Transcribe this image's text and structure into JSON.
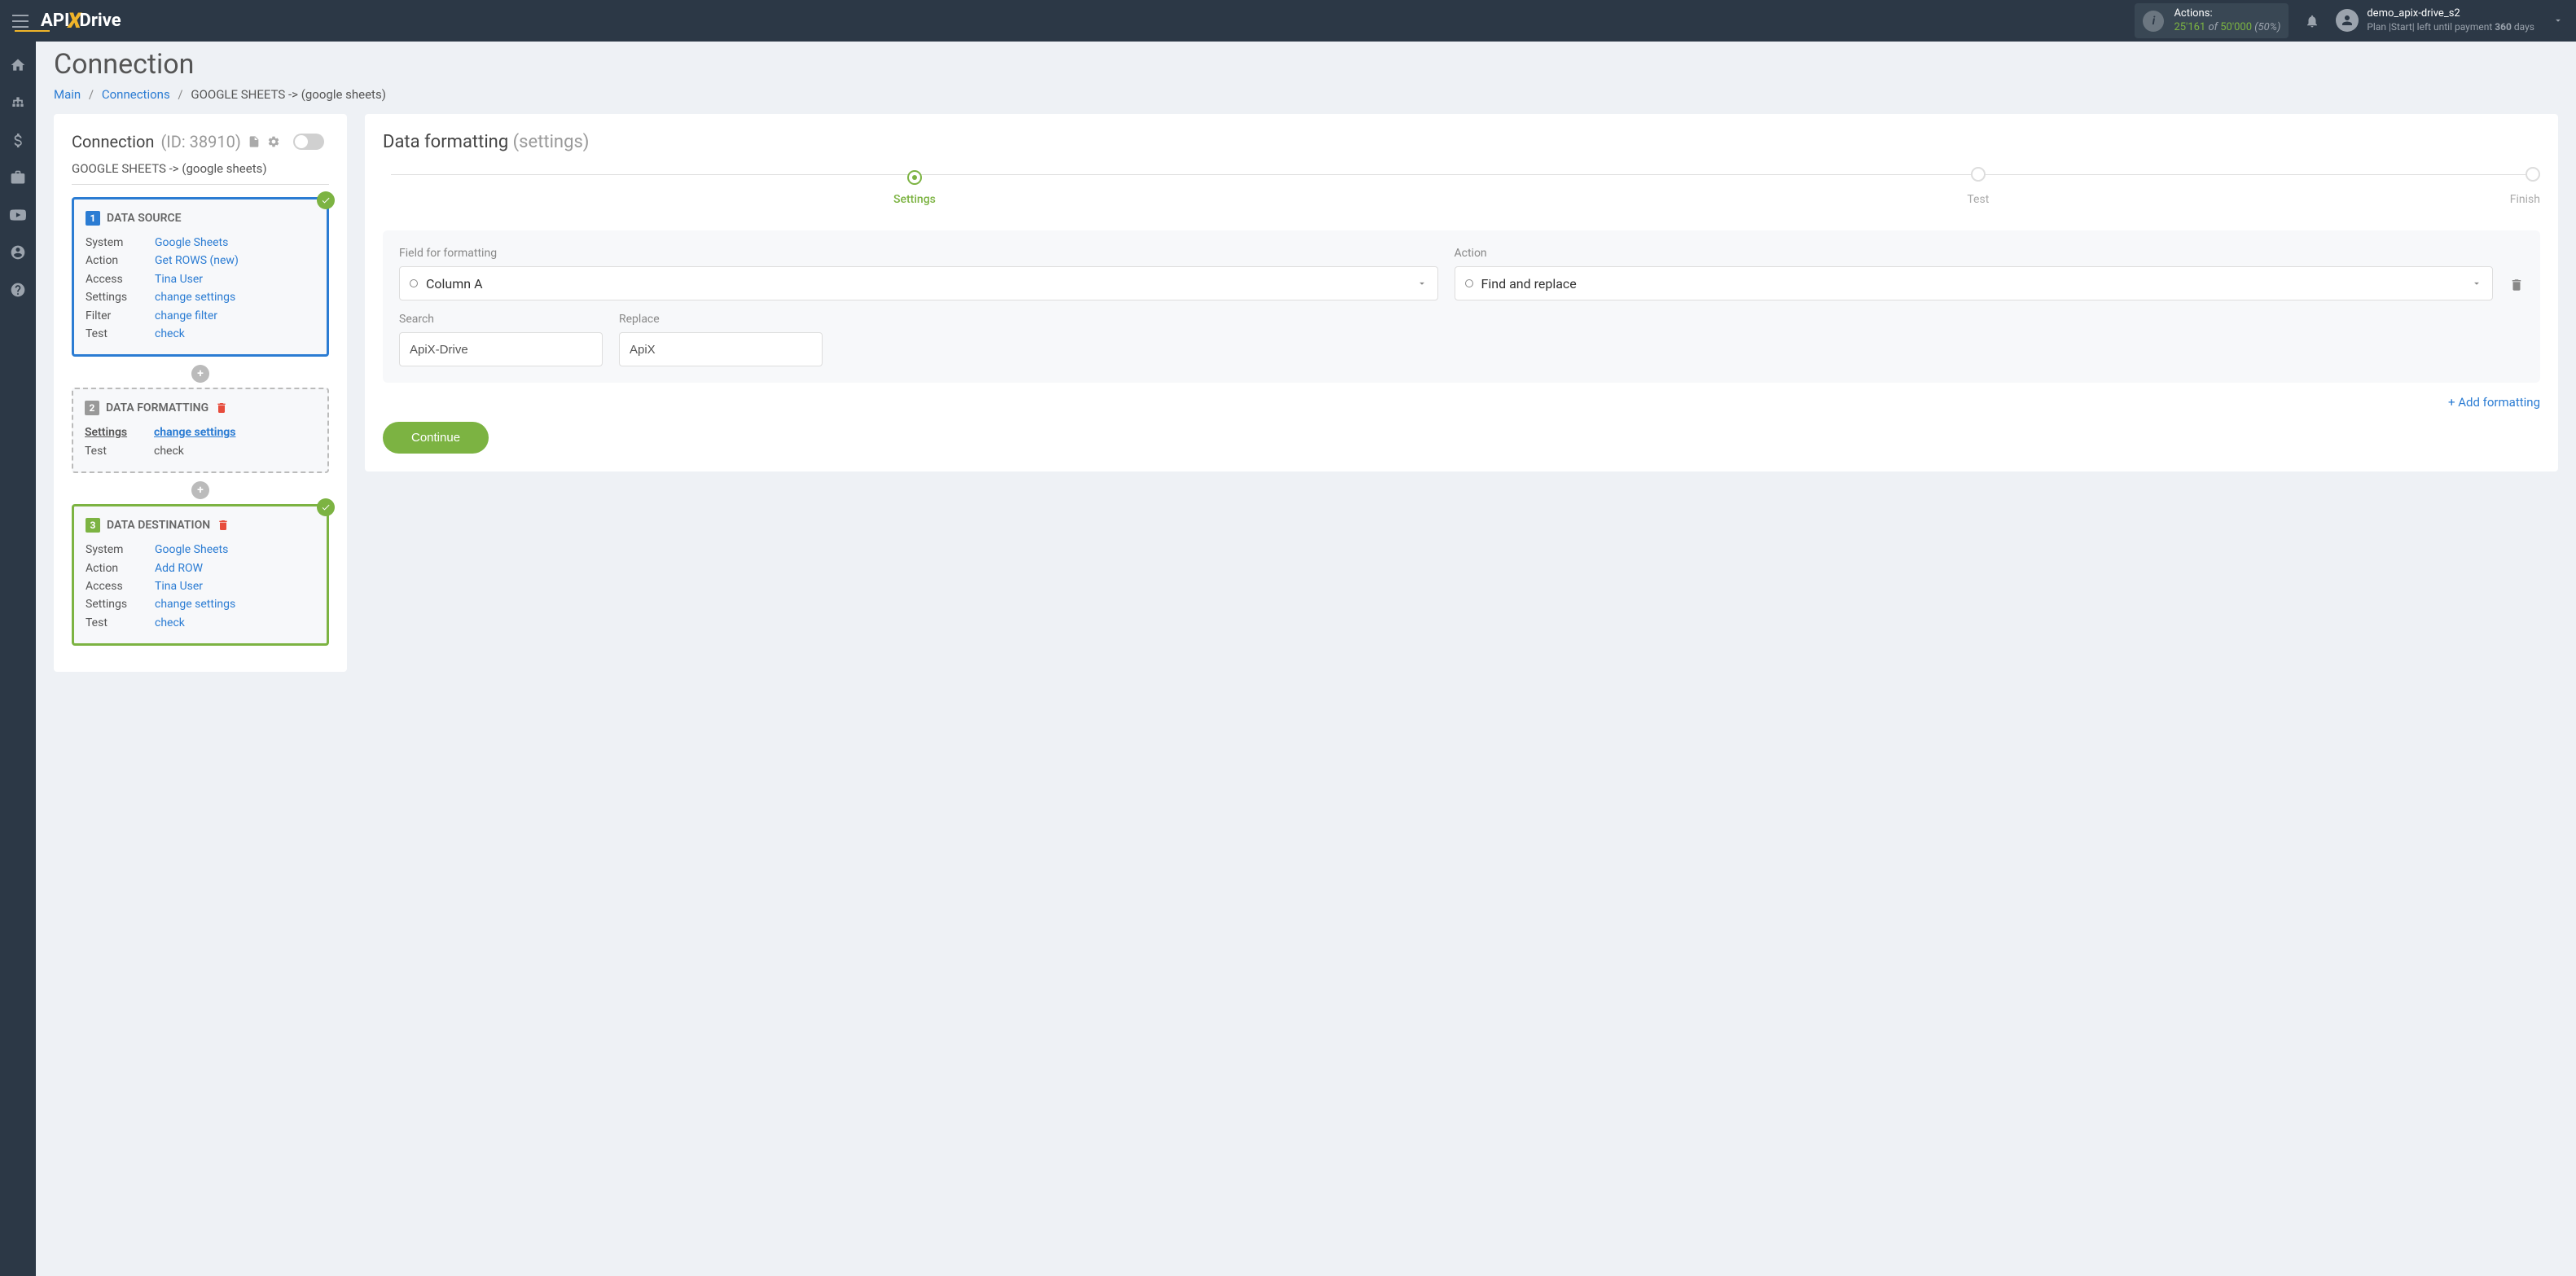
{
  "header": {
    "actions_label": "Actions:",
    "actions_used": "25'161",
    "actions_of": " of ",
    "actions_total": "50'000",
    "actions_pct": " (50%)",
    "username": "demo_apix-drive_s2",
    "plan_prefix": "Plan |Start| left until payment ",
    "plan_days": "360",
    "plan_suffix": " days"
  },
  "page": {
    "title": "Connection",
    "breadcrumb": {
      "main": "Main",
      "connections": "Connections",
      "current": "GOOGLE SHEETS -> (google sheets)"
    }
  },
  "left_panel": {
    "title": "Connection",
    "id_label": "(ID: 38910)",
    "subtitle": "GOOGLE SHEETS -> (google sheets)",
    "source": {
      "header": "DATA SOURCE",
      "rows": {
        "system_label": "System",
        "system_value": "Google Sheets",
        "action_label": "Action",
        "action_value": "Get ROWS (new)",
        "access_label": "Access",
        "access_value": "Tina User",
        "settings_label": "Settings",
        "settings_value": "change settings",
        "filter_label": "Filter",
        "filter_value": "change filter",
        "test_label": "Test",
        "test_value": "check"
      }
    },
    "formatting": {
      "header": "DATA FORMATTING",
      "rows": {
        "settings_label": "Settings",
        "settings_value": "change settings",
        "test_label": "Test",
        "test_value": "check"
      }
    },
    "destination": {
      "header": "DATA DESTINATION",
      "rows": {
        "system_label": "System",
        "system_value": "Google Sheets",
        "action_label": "Action",
        "action_value": "Add ROW",
        "access_label": "Access",
        "access_value": "Tina User",
        "settings_label": "Settings",
        "settings_value": "change settings",
        "test_label": "Test",
        "test_value": "check"
      }
    }
  },
  "right_panel": {
    "title": "Data formatting ",
    "title_sub": "(settings)",
    "steps": {
      "settings": "Settings",
      "test": "Test",
      "finish": "Finish"
    },
    "form": {
      "field_label": "Field for formatting",
      "field_value": "Column A",
      "action_label": "Action",
      "action_value": "Find and replace",
      "search_label": "Search",
      "search_value": "ApiX-Drive",
      "replace_label": "Replace",
      "replace_value": "ApiX"
    },
    "add_formatting": "Add formatting",
    "continue": "Continue"
  }
}
